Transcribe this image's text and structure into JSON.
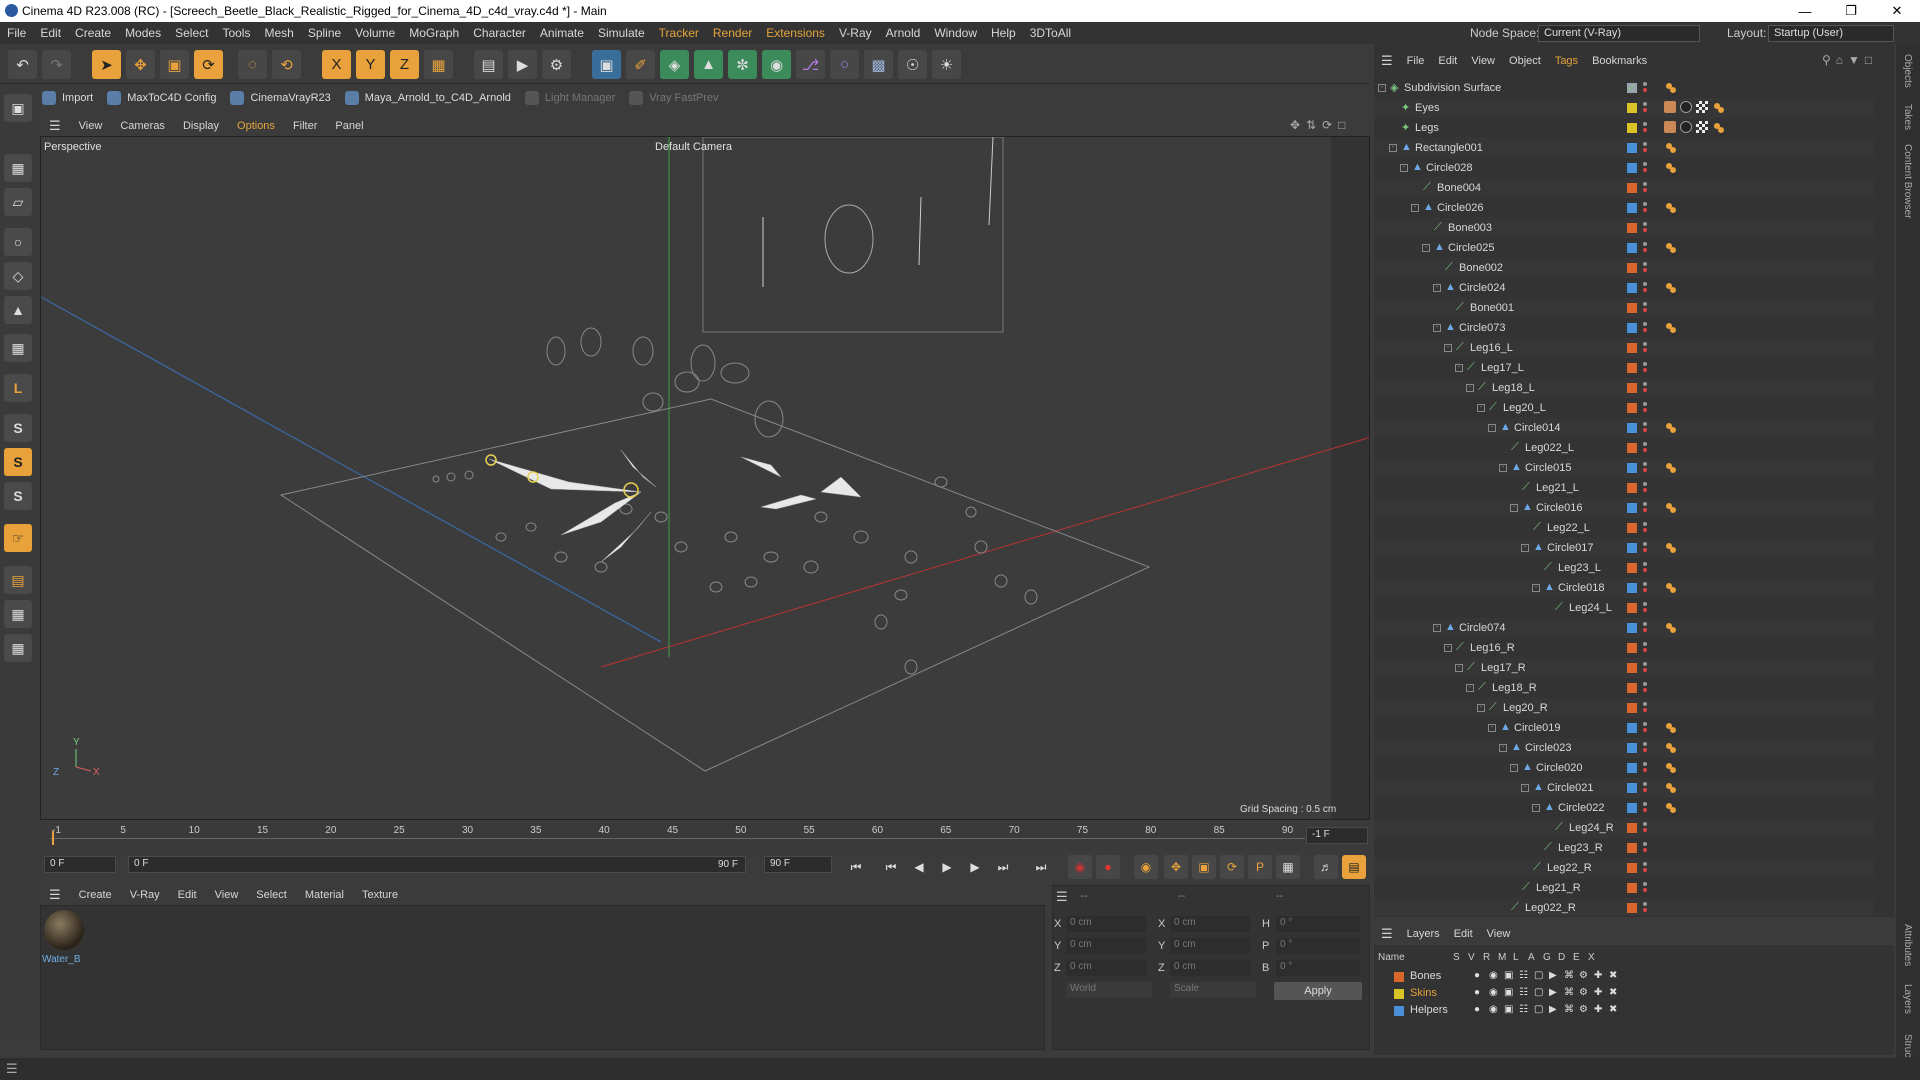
{
  "window": {
    "title": "Cinema 4D R23.008 (RC) - [Screech_Beetle_Black_Realistic_Rigged_for_Cinema_4D_c4d_vray.c4d *] - Main"
  },
  "menu": [
    "File",
    "Edit",
    "Create",
    "Modes",
    "Select",
    "Tools",
    "Mesh",
    "Spline",
    "Volume",
    "MoGraph",
    "Character",
    "Animate",
    "Simulate",
    "Tracker",
    "Render",
    "Extensions",
    "V-Ray",
    "Arnold",
    "Window",
    "Help",
    "3DToAll"
  ],
  "node_space": {
    "label": "Node Space:",
    "value": "Current (V-Ray)"
  },
  "layout": {
    "label": "Layout:",
    "value": "Startup (User)"
  },
  "scripts": [
    {
      "label": "Import",
      "enabled": true
    },
    {
      "label": "MaxToC4D Config",
      "enabled": true
    },
    {
      "label": "CinemaVrayR23",
      "enabled": true
    },
    {
      "label": "Maya_Arnold_to_C4D_Arnold",
      "enabled": true
    },
    {
      "label": "Light Manager",
      "enabled": false
    },
    {
      "label": "Vray FastPrev",
      "enabled": false
    }
  ],
  "viewport_menu": [
    "View",
    "Cameras",
    "Display",
    "Options",
    "Filter",
    "Panel"
  ],
  "viewport": {
    "name": "Perspective",
    "camera": "Default Camera",
    "grid_spacing": "Grid Spacing : 0.5 cm"
  },
  "timeline": {
    "ticks": [
      "-1",
      "5",
      "10",
      "15",
      "20",
      "25",
      "30",
      "35",
      "40",
      "45",
      "50",
      "55",
      "60",
      "65",
      "70",
      "75",
      "80",
      "85",
      "90"
    ],
    "end_label": "-1 F"
  },
  "frames": {
    "current": "0 F",
    "start": "0 F",
    "end": "90 F",
    "max": "90 F"
  },
  "material_menu": [
    "Create",
    "V-Ray",
    "Edit",
    "View",
    "Select",
    "Material",
    "Texture"
  ],
  "material": {
    "name": "Water_B"
  },
  "attributes": {
    "header_1": "--",
    "header_2": "--",
    "header_3": "--",
    "x_label": "X",
    "y_label": "Y",
    "z_label": "Z",
    "x_size_label": "X",
    "y_size_label": "Y",
    "z_size_label": "Z",
    "h_label": "H",
    "p_label": "P",
    "b_label": "B",
    "pos_x": "0 cm",
    "pos_y": "0 cm",
    "pos_z": "0 cm",
    "size_x": "0 cm",
    "size_y": "0 cm",
    "size_z": "0 cm",
    "rot_h": "0 °",
    "rot_p": "0 °",
    "rot_b": "0 °",
    "coord_mode": "World",
    "size_mode": "Scale",
    "apply": "Apply"
  },
  "objects_menu": [
    "File",
    "Edit",
    "View",
    "Object",
    "Tags",
    "Bookmarks"
  ],
  "objects": [
    {
      "name": "Subdivision Surface",
      "depth": 0,
      "color": "#9aa4ad",
      "type": "sds"
    },
    {
      "name": "Eyes",
      "depth": 1,
      "color": "#d8c427",
      "type": "null"
    },
    {
      "name": "Legs",
      "depth": 1,
      "color": "#d8c427",
      "type": "null"
    },
    {
      "name": "Rectangle001",
      "depth": 1,
      "color": "#4a90d9",
      "type": "spline"
    },
    {
      "name": "Circle028",
      "depth": 2,
      "color": "#4a90d9",
      "type": "spline"
    },
    {
      "name": "Bone004",
      "depth": 3,
      "color": "#d9662a",
      "type": "bone"
    },
    {
      "name": "Circle026",
      "depth": 3,
      "color": "#4a90d9",
      "type": "spline"
    },
    {
      "name": "Bone003",
      "depth": 4,
      "color": "#d9662a",
      "type": "bone"
    },
    {
      "name": "Circle025",
      "depth": 4,
      "color": "#4a90d9",
      "type": "spline"
    },
    {
      "name": "Bone002",
      "depth": 5,
      "color": "#d9662a",
      "type": "bone"
    },
    {
      "name": "Circle024",
      "depth": 5,
      "color": "#4a90d9",
      "type": "spline"
    },
    {
      "name": "Bone001",
      "depth": 6,
      "color": "#d9662a",
      "type": "bone"
    },
    {
      "name": "Circle073",
      "depth": 5,
      "color": "#4a90d9",
      "type": "spline"
    },
    {
      "name": "Leg16_L",
      "depth": 6,
      "color": "#d9662a",
      "type": "bone"
    },
    {
      "name": "Leg17_L",
      "depth": 7,
      "color": "#d9662a",
      "type": "bone"
    },
    {
      "name": "Leg18_L",
      "depth": 8,
      "color": "#d9662a",
      "type": "bone"
    },
    {
      "name": "Leg20_L",
      "depth": 9,
      "color": "#d9662a",
      "type": "bone"
    },
    {
      "name": "Circle014",
      "depth": 10,
      "color": "#4a90d9",
      "type": "spline"
    },
    {
      "name": "Leg022_L",
      "depth": 11,
      "color": "#d9662a",
      "type": "bone"
    },
    {
      "name": "Circle015",
      "depth": 11,
      "color": "#4a90d9",
      "type": "spline"
    },
    {
      "name": "Leg21_L",
      "depth": 12,
      "color": "#d9662a",
      "type": "bone"
    },
    {
      "name": "Circle016",
      "depth": 12,
      "color": "#4a90d9",
      "type": "spline"
    },
    {
      "name": "Leg22_L",
      "depth": 13,
      "color": "#d9662a",
      "type": "bone"
    },
    {
      "name": "Circle017",
      "depth": 13,
      "color": "#4a90d9",
      "type": "spline"
    },
    {
      "name": "Leg23_L",
      "depth": 14,
      "color": "#d9662a",
      "type": "bone"
    },
    {
      "name": "Circle018",
      "depth": 14,
      "color": "#4a90d9",
      "type": "spline"
    },
    {
      "name": "Leg24_L",
      "depth": 15,
      "color": "#d9662a",
      "type": "bone"
    },
    {
      "name": "Circle074",
      "depth": 5,
      "color": "#4a90d9",
      "type": "spline"
    },
    {
      "name": "Leg16_R",
      "depth": 6,
      "color": "#d9662a",
      "type": "bone"
    },
    {
      "name": "Leg17_R",
      "depth": 7,
      "color": "#d9662a",
      "type": "bone"
    },
    {
      "name": "Leg18_R",
      "depth": 8,
      "color": "#d9662a",
      "type": "bone"
    },
    {
      "name": "Leg20_R",
      "depth": 9,
      "color": "#d9662a",
      "type": "bone"
    },
    {
      "name": "Circle019",
      "depth": 10,
      "color": "#4a90d9",
      "type": "spline"
    },
    {
      "name": "Circle023",
      "depth": 11,
      "color": "#4a90d9",
      "type": "spline"
    },
    {
      "name": "Circle020",
      "depth": 12,
      "color": "#4a90d9",
      "type": "spline"
    },
    {
      "name": "Circle021",
      "depth": 13,
      "color": "#4a90d9",
      "type": "spline"
    },
    {
      "name": "Circle022",
      "depth": 14,
      "color": "#4a90d9",
      "type": "spline"
    },
    {
      "name": "Leg24_R",
      "depth": 15,
      "color": "#d9662a",
      "type": "bone"
    },
    {
      "name": "Leg23_R",
      "depth": 14,
      "color": "#d9662a",
      "type": "bone"
    },
    {
      "name": "Leg22_R",
      "depth": 13,
      "color": "#d9662a",
      "type": "bone"
    },
    {
      "name": "Leg21_R",
      "depth": 12,
      "color": "#d9662a",
      "type": "bone"
    },
    {
      "name": "Leg022_R",
      "depth": 11,
      "color": "#d9662a",
      "type": "bone"
    }
  ],
  "layers_menu": [
    "Layers",
    "Edit",
    "View"
  ],
  "layers_columns": [
    "Name",
    "S",
    "V",
    "R",
    "M",
    "L",
    "A",
    "G",
    "D",
    "E",
    "X"
  ],
  "layers": [
    {
      "name": "Bones",
      "color": "#d9662a",
      "selected": false
    },
    {
      "name": "Skins",
      "color": "#d8c427",
      "selected": true
    },
    {
      "name": "Helpers",
      "color": "#4a90d9",
      "selected": false
    }
  ],
  "side_tabs": [
    "Objects",
    "Takes",
    "Content Browser",
    "Attributes",
    "Layers",
    "Struct"
  ]
}
